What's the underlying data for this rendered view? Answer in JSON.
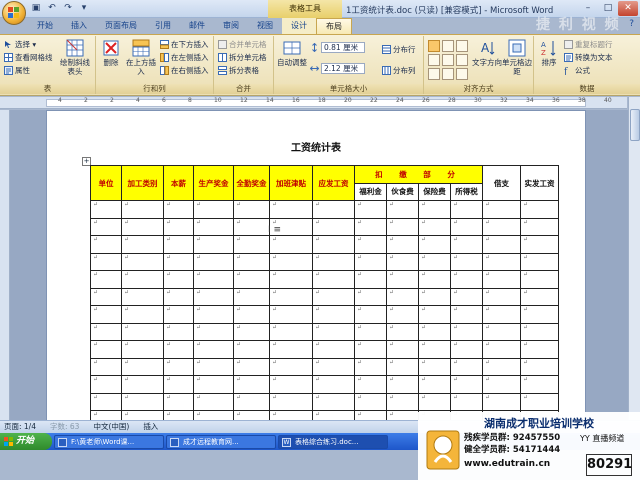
{
  "window": {
    "title": "1工资统计表.doc (只读) [兼容模式] - Microsoft Word",
    "context_tab_title": "表格工具",
    "controls": {
      "minimize": "–",
      "maximize": "□",
      "close": "✕"
    }
  },
  "quick_access": {
    "icons": [
      "save-icon",
      "undo-icon",
      "redo-icon",
      "customize-icon"
    ],
    "glyphs": {
      "save": "▣",
      "undo": "↶",
      "redo": "↷",
      "more": "▾"
    }
  },
  "tabs": [
    {
      "label": "开始"
    },
    {
      "label": "插入"
    },
    {
      "label": "页面布局"
    },
    {
      "label": "引用"
    },
    {
      "label": "邮件"
    },
    {
      "label": "审阅"
    },
    {
      "label": "视图"
    },
    {
      "label": "设计"
    },
    {
      "label": "布局"
    }
  ],
  "active_tab": "布局",
  "help_glyph": "?",
  "ribbon": {
    "table": {
      "label": "表",
      "select": "选择 ▾",
      "gridlines": "查看网格线",
      "properties": "属性"
    },
    "draw": {
      "draw_border": "绘制斜线表头"
    },
    "rows_cols": {
      "label": "行和列",
      "delete": "删除",
      "insert_above": "在上方插入",
      "insert_below": "在下方插入",
      "insert_left": "在左侧插入",
      "insert_right": "在右侧插入"
    },
    "merge": {
      "label": "合并",
      "merge_cells": "合并单元格",
      "split_cells": "拆分单元格",
      "split_table": "拆分表格"
    },
    "cell_size": {
      "label": "单元格大小",
      "autofit": "自动调整",
      "height": "0.81 厘米",
      "width": "2.12 厘米",
      "distribute_rows": "分布行",
      "distribute_cols": "分布列"
    },
    "alignment": {
      "label": "对齐方式",
      "text_direction": "文字方向",
      "cell_margins": "单元格边距"
    },
    "data": {
      "label": "数据",
      "sort": "排序",
      "repeat_header": "重复标题行",
      "convert_to_text": "转换为文本",
      "formula": "公式"
    }
  },
  "ruler_numbers": [
    "4",
    "2",
    "2",
    "4",
    "6",
    "8",
    "10",
    "12",
    "14",
    "16",
    "18",
    "20",
    "22",
    "24",
    "26",
    "28",
    "30",
    "32",
    "34",
    "36",
    "38",
    "40"
  ],
  "document": {
    "title": "工资统计表",
    "table": {
      "headers": [
        "单位",
        "加工类别",
        "本薪",
        "生产奖金",
        "全勤奖金",
        "加班津贴",
        "应发工资"
      ],
      "deduction_header": "扣 缴 部 分",
      "deduction_subheaders": [
        "福利金",
        "伙食费",
        "保险费",
        "所得税"
      ],
      "borrow_header": "借支",
      "net_pay_header": "实发工资",
      "cell_mark": "↵",
      "body_rows": 13
    },
    "cursor_glyph": "Ⅰ ≡"
  },
  "statusbar": {
    "page": "页面: 1/4",
    "words": "字数: 63",
    "lang": "中文(中国)",
    "mode": "插入"
  },
  "taskbar": {
    "start": "开始",
    "items": [
      {
        "label": "F:\\黄老师\\Word课..."
      },
      {
        "label": "成才远程教育网..."
      },
      {
        "label": "表格综合练习.doc..."
      }
    ]
  },
  "overlay": {
    "watermark": "捷 利 视 频",
    "school_name": "湖南成才职业培训学校",
    "phone_1": "残疾学员群: 92457550",
    "phone_2": "健全学员群: 54171444",
    "url": "www.edutrain.cn",
    "channel_label": "YY 直播频道",
    "channel_number": "80291"
  }
}
